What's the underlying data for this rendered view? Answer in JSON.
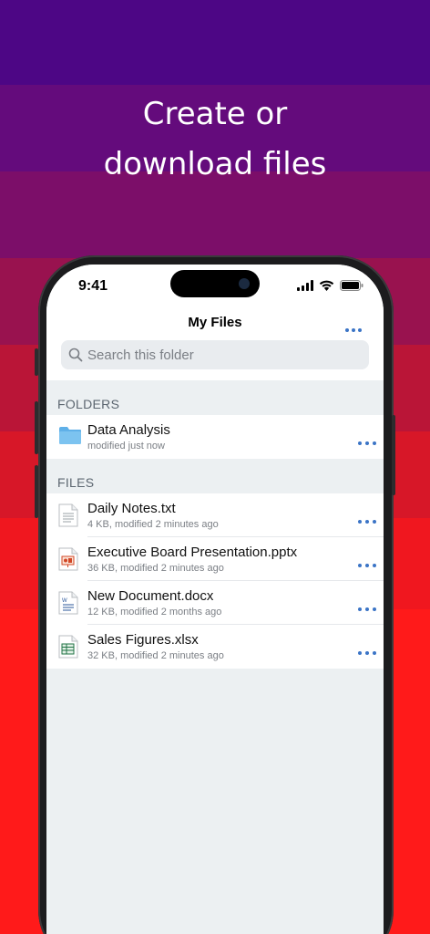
{
  "headline": {
    "line1": "Create or",
    "line2": "download files"
  },
  "colors": {
    "bands": [
      "#4d0685",
      "#640b7c",
      "#7c0e69",
      "#99124f",
      "#ba1537",
      "#d71728",
      "#f0171f",
      "#ff1a1a"
    ],
    "accent": "#3b74c6",
    "folder": "#6db6e8"
  },
  "status_bar": {
    "time": "9:41",
    "icons": [
      "signal-icon",
      "wifi-icon",
      "battery-icon"
    ]
  },
  "nav": {
    "title": "My Files",
    "more_icon": "more-icon"
  },
  "search": {
    "placeholder": "Search this folder",
    "icon": "search-icon"
  },
  "folders": {
    "header": "FOLDERS",
    "items": [
      {
        "name": "Data Analysis",
        "meta": "modified just now",
        "icon": "folder-icon"
      }
    ]
  },
  "files": {
    "header": "FILES",
    "items": [
      {
        "name": "Daily Notes.txt",
        "meta": "4 KB, modified 2 minutes ago",
        "icon": "text-file-icon"
      },
      {
        "name": "Executive Board Presentation.pptx",
        "meta": "36 KB, modified 2 minutes ago",
        "icon": "presentation-file-icon"
      },
      {
        "name": "New Document.docx",
        "meta": "12 KB, modified 2 months ago",
        "icon": "word-file-icon"
      },
      {
        "name": "Sales Figures.xlsx",
        "meta": "32 KB, modified 2 minutes ago",
        "icon": "spreadsheet-file-icon"
      }
    ]
  }
}
